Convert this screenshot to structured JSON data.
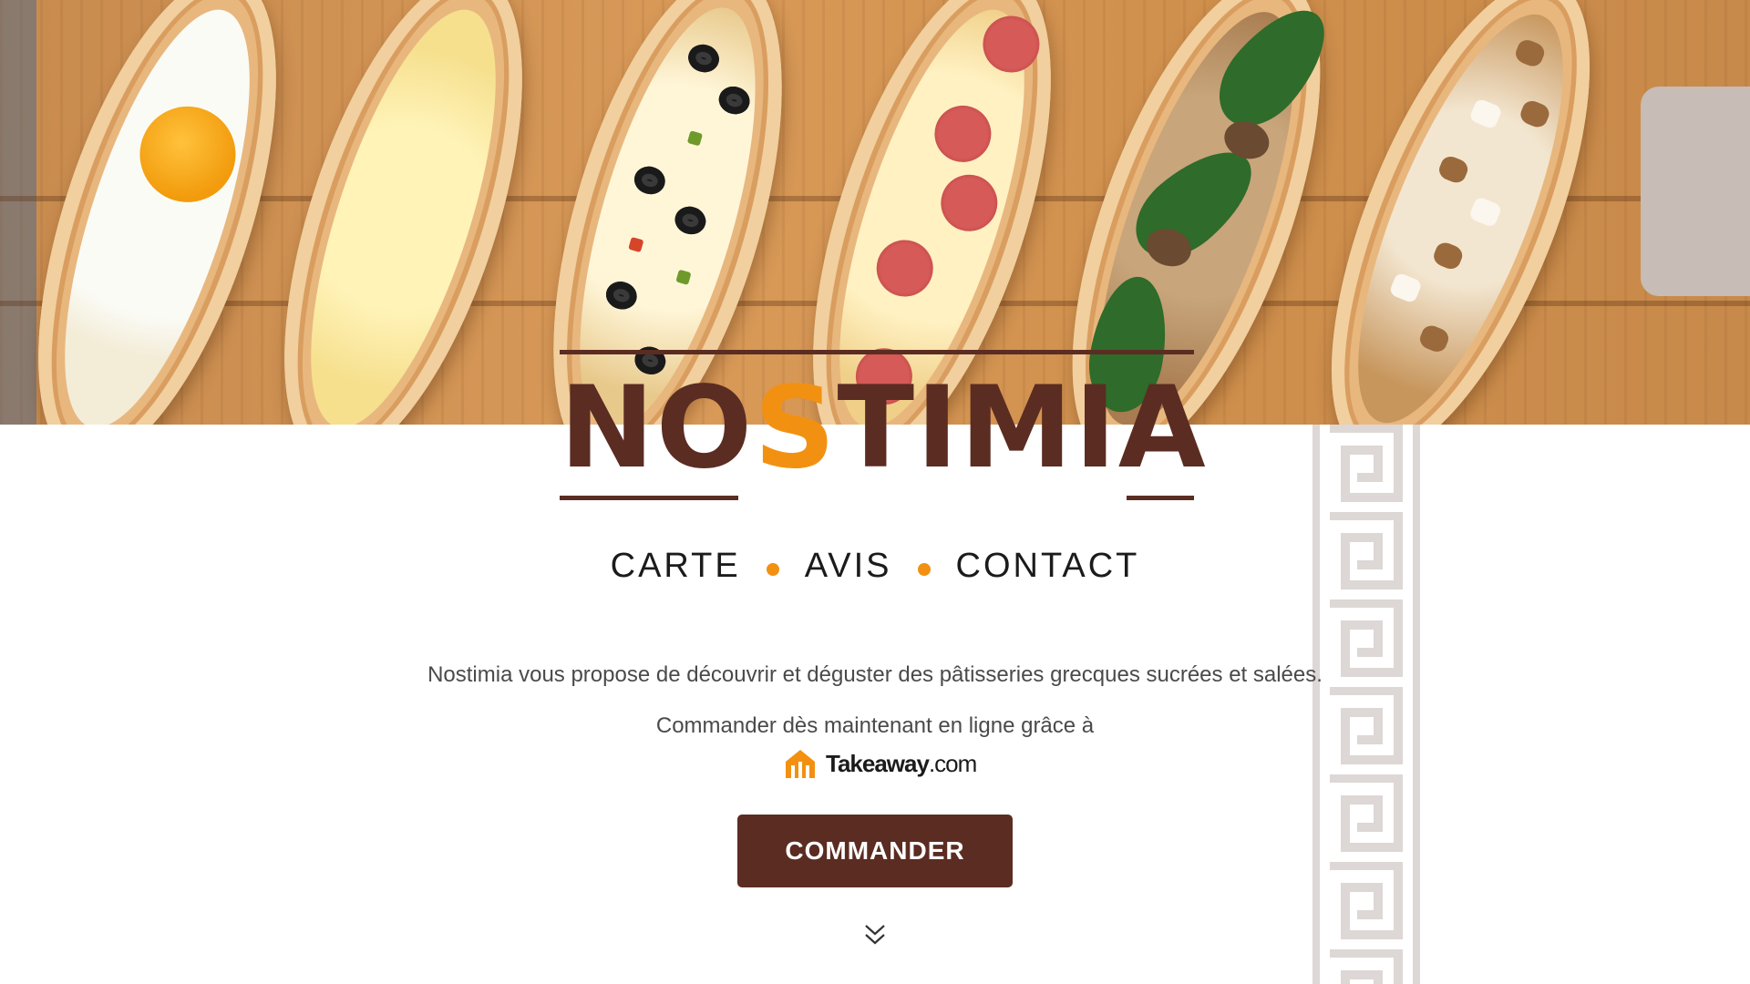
{
  "brand": {
    "name_part1": "NO",
    "name_accent": "S",
    "name_part2": "TIMIA",
    "accent_color": "#f29111",
    "primary_color": "#5b2c22"
  },
  "nav": {
    "items": [
      {
        "label": "CARTE"
      },
      {
        "label": "AVIS"
      },
      {
        "label": "CONTACT"
      }
    ]
  },
  "intro": {
    "line1": "Nostimia vous propose de découvrir et déguster des pâtisseries grecques sucrées et salées.",
    "line2": "Commander dès maintenant en ligne grâce à"
  },
  "takeaway": {
    "name": "Takeaway",
    "suffix": ".com"
  },
  "cta": {
    "label": "COMMANDER"
  },
  "icons": {
    "scroll": "double-chevron-down-icon",
    "takeaway": "takeaway-house-icon"
  }
}
